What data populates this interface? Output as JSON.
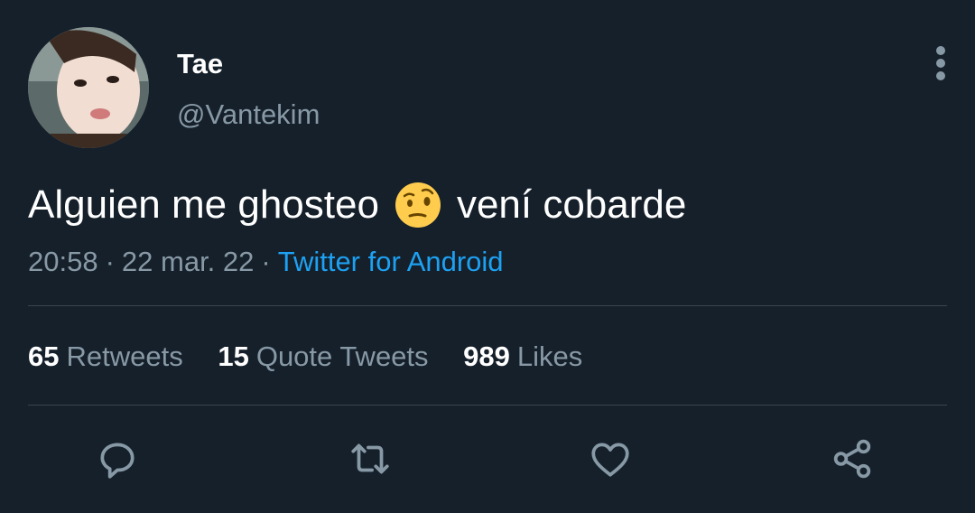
{
  "user": {
    "display_name": "Tae",
    "handle": "@Vantekim"
  },
  "tweet": {
    "text_before": "Alguien me ghosteo",
    "emoji": "face-with-raised-eyebrow",
    "text_after": "vení cobarde",
    "time": "20:58",
    "separator": "·",
    "date": "22 mar. 22",
    "source": "Twitter for Android"
  },
  "stats": [
    {
      "count": "65",
      "label": "Retweets"
    },
    {
      "count": "15",
      "label": "Quote Tweets"
    },
    {
      "count": "989",
      "label": "Likes"
    }
  ],
  "actions": [
    "reply-icon",
    "retweet-icon",
    "like-icon",
    "share-icon"
  ],
  "colors": {
    "background": "#15202b",
    "primary_text": "#ffffff",
    "secondary_text": "#8899a6",
    "link": "#1da1f2",
    "divider": "#38444d"
  }
}
